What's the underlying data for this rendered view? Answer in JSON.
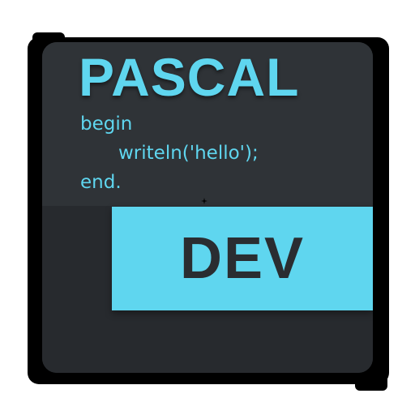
{
  "icon": {
    "title": "PASCAL",
    "code_lines": [
      "begin",
      "writeln('hello');",
      "end."
    ],
    "badge_label": "DEV",
    "colors": {
      "accent": "#5fd6ef",
      "card_background": "#2b2f33",
      "frame": "#000000",
      "badge_text": "#2a2d31"
    }
  }
}
